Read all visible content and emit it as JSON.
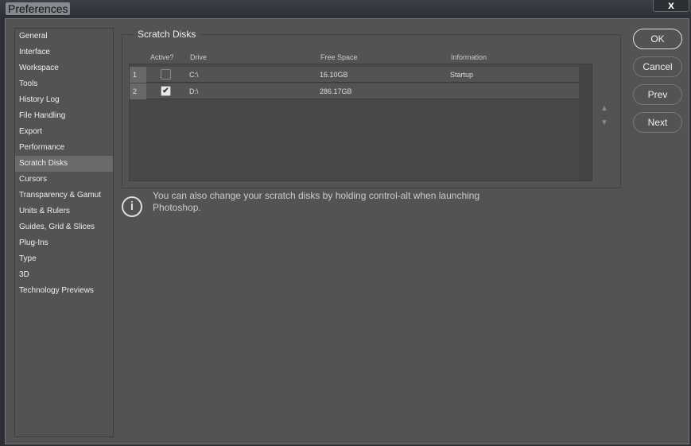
{
  "window": {
    "title": "Preferences",
    "close": "x"
  },
  "sidebar": {
    "items": [
      "General",
      "Interface",
      "Workspace",
      "Tools",
      "History Log",
      "File Handling",
      "Export",
      "Performance",
      "Scratch Disks",
      "Cursors",
      "Transparency & Gamut",
      "Units & Rulers",
      "Guides, Grid & Slices",
      "Plug-Ins",
      "Type",
      "3D",
      "Technology Previews"
    ],
    "selected": "Scratch Disks"
  },
  "panel": {
    "title": "Scratch Disks",
    "headers": {
      "active": "Active?",
      "drive": "Drive",
      "free": "Free Space",
      "info": "Information"
    },
    "rows": [
      {
        "num": "1",
        "active": false,
        "drive": "C:\\",
        "free": "16.10GB",
        "info": "Startup"
      },
      {
        "num": "2",
        "active": true,
        "drive": "D:\\",
        "free": "286.17GB",
        "info": ""
      }
    ],
    "info_text": "You can also change your scratch disks by holding control-alt when launching Photoshop."
  },
  "buttons": {
    "ok": "OK",
    "cancel": "Cancel",
    "prev": "Prev",
    "next": "Next"
  }
}
